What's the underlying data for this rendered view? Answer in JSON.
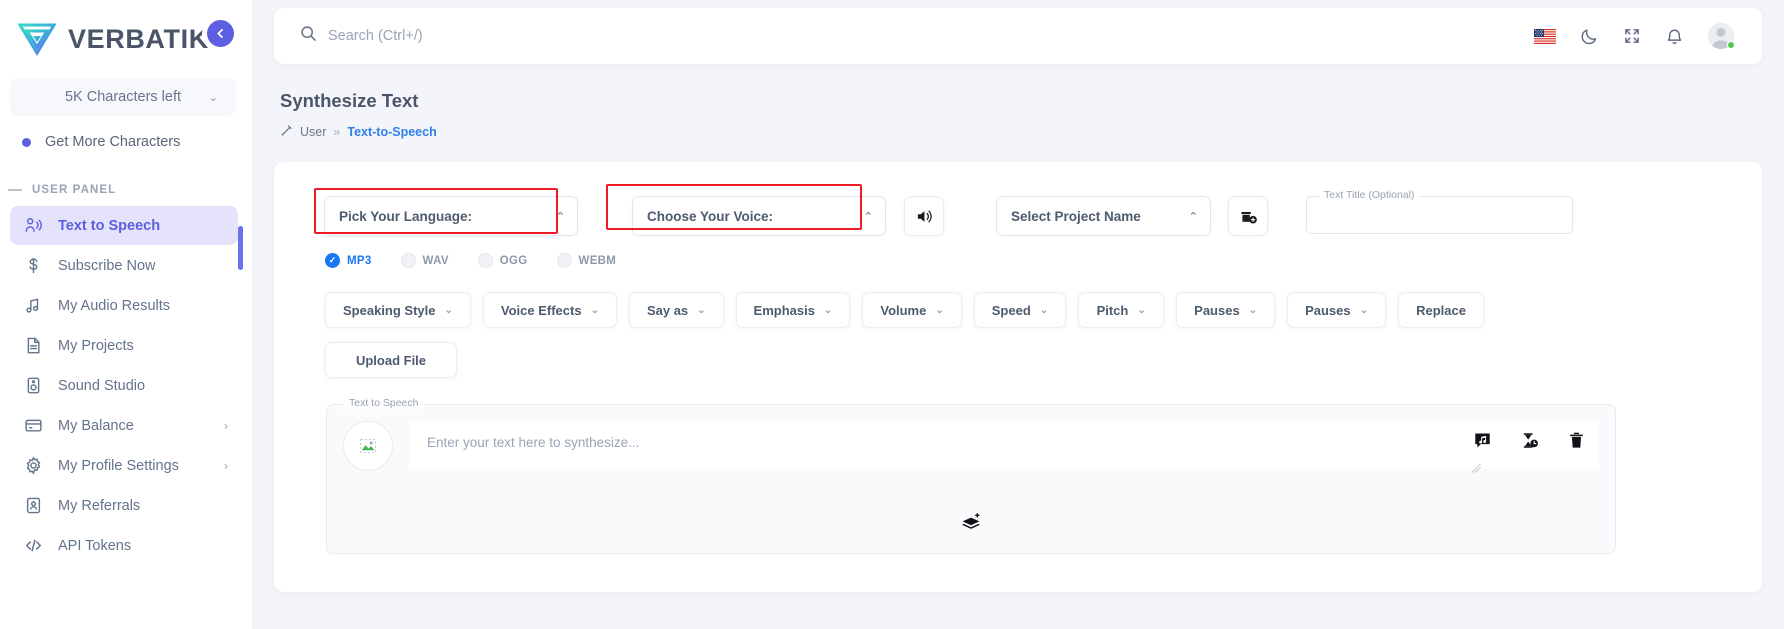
{
  "brand": {
    "name": "VERBATIK"
  },
  "sidebar": {
    "characters_box": {
      "label": "5K Characters left",
      "chevron": "chevron-down"
    },
    "get_more": "Get More Characters",
    "panel_heading": "USER PANEL",
    "items": [
      {
        "label": "Text to Speech",
        "icon": "speaking-person-icon",
        "active": true,
        "caret": ""
      },
      {
        "label": "Subscribe Now",
        "icon": "dollar-icon",
        "active": false,
        "caret": ""
      },
      {
        "label": "My Audio Results",
        "icon": "music-note-icon",
        "active": false,
        "caret": ""
      },
      {
        "label": "My Projects",
        "icon": "document-icon",
        "active": false,
        "caret": ""
      },
      {
        "label": "Sound Studio",
        "icon": "speaker-box-icon",
        "active": false,
        "caret": ""
      },
      {
        "label": "My Balance",
        "icon": "credit-card-icon",
        "active": false,
        "caret": "›"
      },
      {
        "label": "My Profile Settings",
        "icon": "gear-icon",
        "active": false,
        "caret": "›"
      },
      {
        "label": "My Referrals",
        "icon": "user-card-icon",
        "active": false,
        "caret": ""
      },
      {
        "label": "API Tokens",
        "icon": "code-brackets-icon",
        "active": false,
        "caret": ""
      }
    ],
    "collapse_button": {
      "icon": "chevron-left-icon"
    }
  },
  "header": {
    "search": {
      "placeholder": "Search (Ctrl+/)",
      "value": "",
      "icon": "search-icon"
    },
    "icons": [
      {
        "name": "flag-us-icon"
      },
      {
        "name": "moon-icon"
      },
      {
        "name": "fullscreen-icon"
      },
      {
        "name": "bell-icon"
      },
      {
        "name": "avatar-icon"
      }
    ],
    "status": "online"
  },
  "page": {
    "title": "Synthesize Text",
    "breadcrumb": {
      "icon": "wand-icon",
      "root": "User",
      "separator": "»",
      "current": "Text-to-Speech"
    }
  },
  "form": {
    "language_select": {
      "label": "Pick Your Language:",
      "chevron": "chevron-up",
      "highlighted": true
    },
    "voice_select": {
      "label": "Choose Your Voice:",
      "chevron": "chevron-up",
      "highlighted": true
    },
    "preview_button": {
      "icon": "speaker-volume-icon"
    },
    "project_select": {
      "label": "Select Project Name",
      "chevron": "chevron-up"
    },
    "add_project_button": {
      "icon": "add-project-icon"
    },
    "text_title": {
      "legend": "Text Title (Optional)",
      "value": ""
    },
    "formats": [
      {
        "label": "MP3",
        "selected": true
      },
      {
        "label": "WAV",
        "selected": false
      },
      {
        "label": "OGG",
        "selected": false
      },
      {
        "label": "WEBM",
        "selected": false
      }
    ],
    "tools": [
      {
        "label": "Speaking Style",
        "chevron": true
      },
      {
        "label": "Voice Effects",
        "chevron": true
      },
      {
        "label": "Say as",
        "chevron": true
      },
      {
        "label": "Emphasis",
        "chevron": true
      },
      {
        "label": "Volume",
        "chevron": true
      },
      {
        "label": "Speed",
        "chevron": true
      },
      {
        "label": "Pitch",
        "chevron": true
      },
      {
        "label": "Pauses",
        "chevron": true
      },
      {
        "label": "Pauses",
        "chevron": true
      },
      {
        "label": "Replace",
        "chevron": false
      }
    ],
    "upload_button": {
      "label": "Upload File"
    },
    "editor": {
      "legend": "Text to Speech",
      "avatar_icon": "broken-image-icon",
      "textarea": {
        "placeholder": "Enter your text here to synthesize...",
        "value": ""
      },
      "actions": [
        {
          "name": "insert-audio-icon"
        },
        {
          "name": "pause-timing-icon"
        },
        {
          "name": "delete-icon"
        }
      ],
      "add_block_button": {
        "icon": "add-layer-icon"
      }
    }
  },
  "colors": {
    "accent_purple": "#5b5fe0",
    "link_blue": "#2f80ed",
    "radio_blue": "#1877f2",
    "highlight_red": "#ee1c25",
    "online_green": "#4ec94e",
    "page_bg": "#f4f5fa"
  }
}
